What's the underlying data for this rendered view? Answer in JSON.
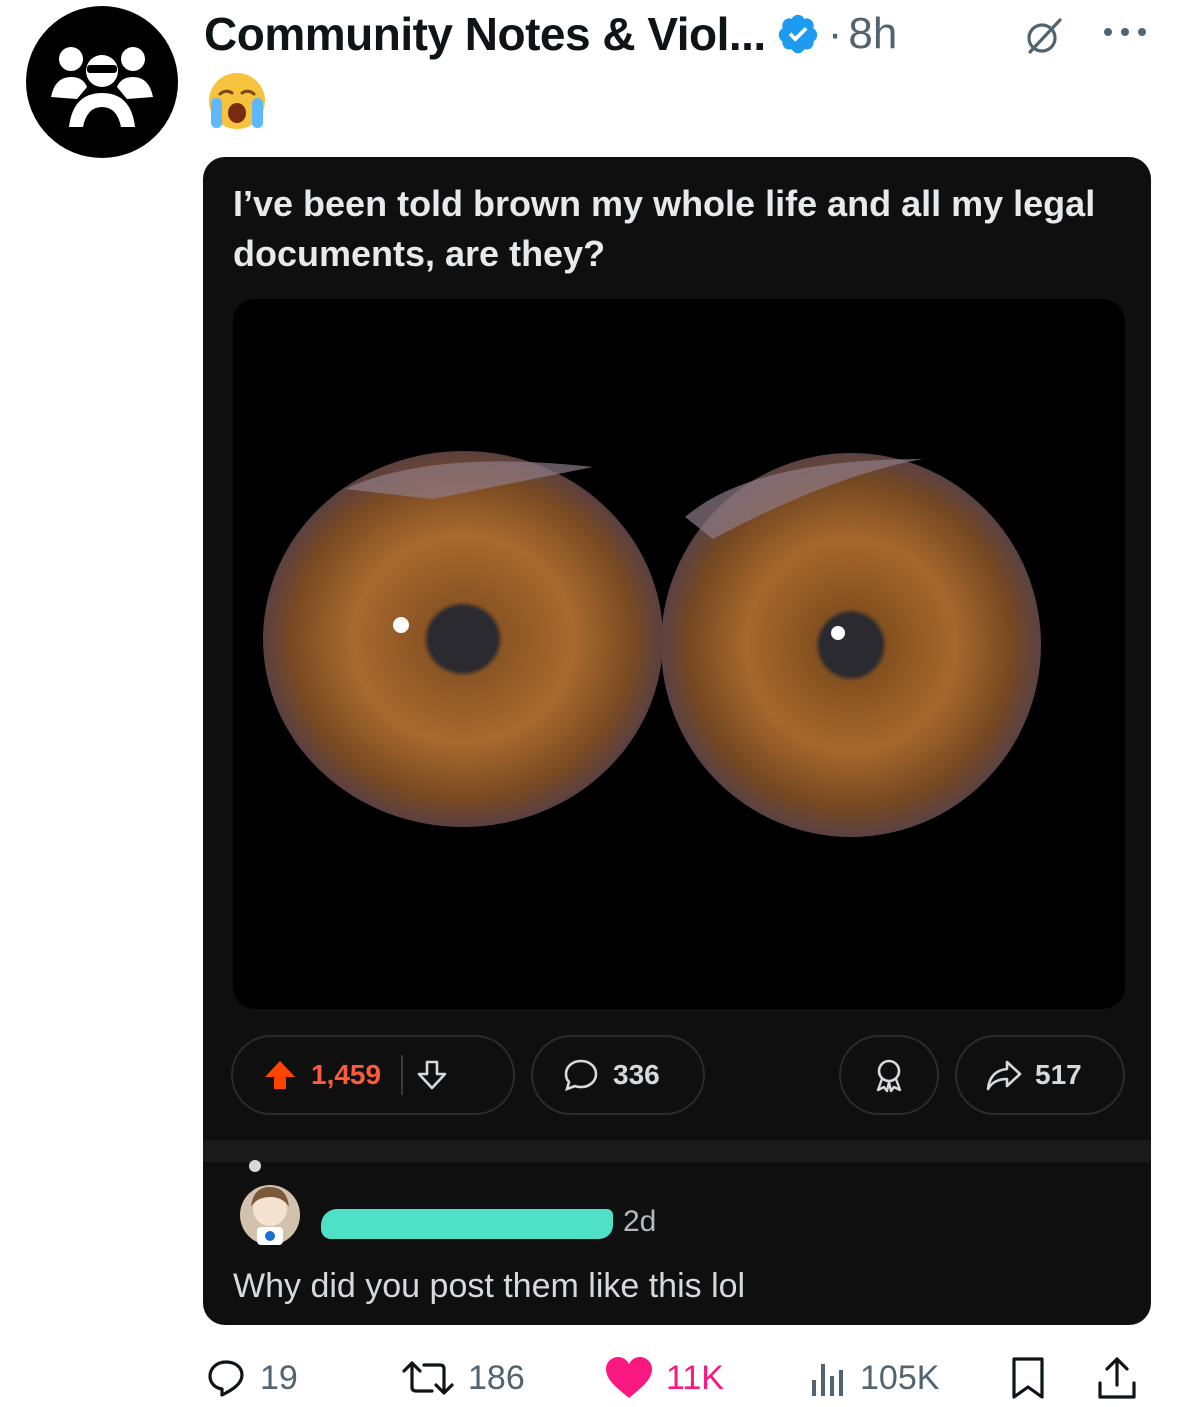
{
  "account": {
    "display_name": "Community Notes & Viol...",
    "separator": "·",
    "time": "8h",
    "post_emoji": "crying-face"
  },
  "embedded_post": {
    "title": "I’ve been told brown my whole life and all my legal documents, are they?",
    "upvotes": "1,459",
    "comments": "336",
    "shares": "517",
    "comment": {
      "age": "2d",
      "text": "Why did you post them like this lol"
    }
  },
  "tweet_actions": {
    "replies": "19",
    "reposts": "186",
    "likes": "11K",
    "views": "105K"
  },
  "colors": {
    "like": "#f91880",
    "verified": "#1d9bf0",
    "upvote": "#ff4500",
    "redaction": "#4fe0c8"
  }
}
